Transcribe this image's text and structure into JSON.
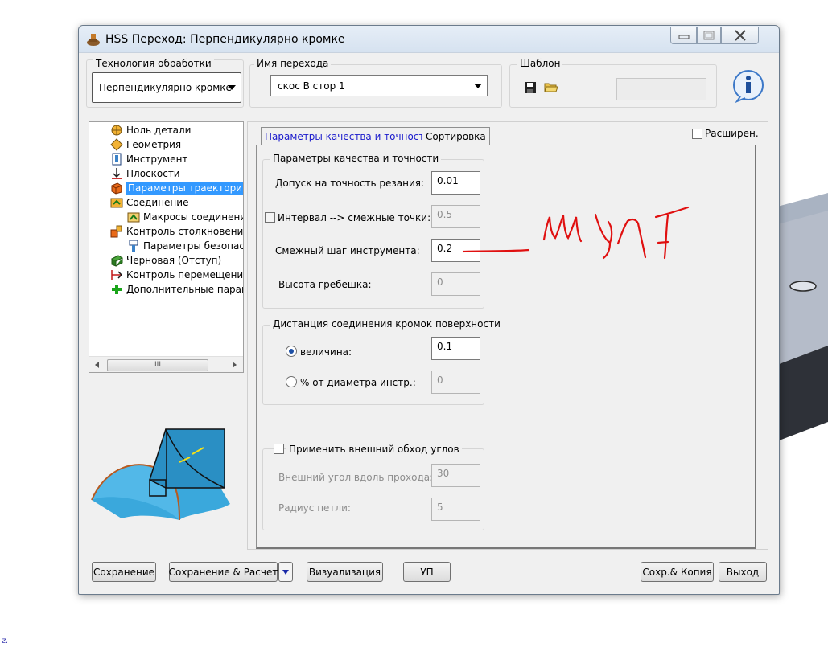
{
  "window": {
    "title": "HSS Переход: Перпендикулярно кромке"
  },
  "technology": {
    "group_label": "Технология обработки",
    "value": "Перпендикулярно кромке"
  },
  "operation_name": {
    "group_label": "Имя перехода",
    "value": "скос В стор 1"
  },
  "template": {
    "group_label": "Шаблон"
  },
  "tree": {
    "items": [
      {
        "label": "Ноль детали",
        "icon": "origin-icon"
      },
      {
        "label": "Геометрия",
        "icon": "geometry-icon"
      },
      {
        "label": "Инструмент",
        "icon": "tool-icon"
      },
      {
        "label": "Плоскости",
        "icon": "planes-icon"
      },
      {
        "label": "Параметры траектории",
        "icon": "toolpath-params-icon"
      },
      {
        "label": "Соединение",
        "icon": "link-icon"
      },
      {
        "label": "Макросы соединения",
        "icon": "link-macros-icon"
      },
      {
        "label": "Контроль столкновений",
        "icon": "collision-icon"
      },
      {
        "label": "Параметры безопасности",
        "icon": "safety-icon"
      },
      {
        "label": "Черновая (Отступ)",
        "icon": "roughing-icon"
      },
      {
        "label": "Контроль перемещений",
        "icon": "motion-icon"
      },
      {
        "label": "Дополнительные параметры",
        "icon": "plus-icon"
      }
    ],
    "selected_index": 4,
    "scroll_thumb": "III"
  },
  "tabs": [
    {
      "label": "Параметры качества и точности"
    },
    {
      "label": "Сортировка"
    }
  ],
  "extended_label": "Расширен.",
  "quality": {
    "group_label": "Параметры качества и точности",
    "tolerance_label": "Допуск на  точность резания:",
    "tolerance_value": "0.01",
    "interval_label": "Интервал --> смежные точки:",
    "interval_value": "0.5",
    "stepover_label": "Смежный шаг инструмента:",
    "stepover_value": "0.2",
    "scallop_label": "Высота гребешка:",
    "scallop_value": "0"
  },
  "edge_distance": {
    "group_label": "Дистанция соединения кромок поверхности",
    "value_label": "величина:",
    "value": "0.1",
    "percent_label": "% от диаметра инстр.:",
    "percent_value": "0"
  },
  "corners": {
    "apply_label": "Применить внешний обход углов",
    "angle_label": "Внешний угол вдоль прохода:",
    "angle_value": "30",
    "radius_label": "Радиус петли:",
    "radius_value": "5"
  },
  "buttons": {
    "save": "Сохранение",
    "save_calc": "Сохранение & Расчет",
    "visualize": "Визуализация",
    "nc": "УП",
    "save_copy": "Сохр.& Копия",
    "exit": "Выход"
  },
  "corner_mark": "z.",
  "colors": {
    "selection": "#3399ff",
    "annotation": "#e01010",
    "active_tab_text": "#1a1acc"
  }
}
